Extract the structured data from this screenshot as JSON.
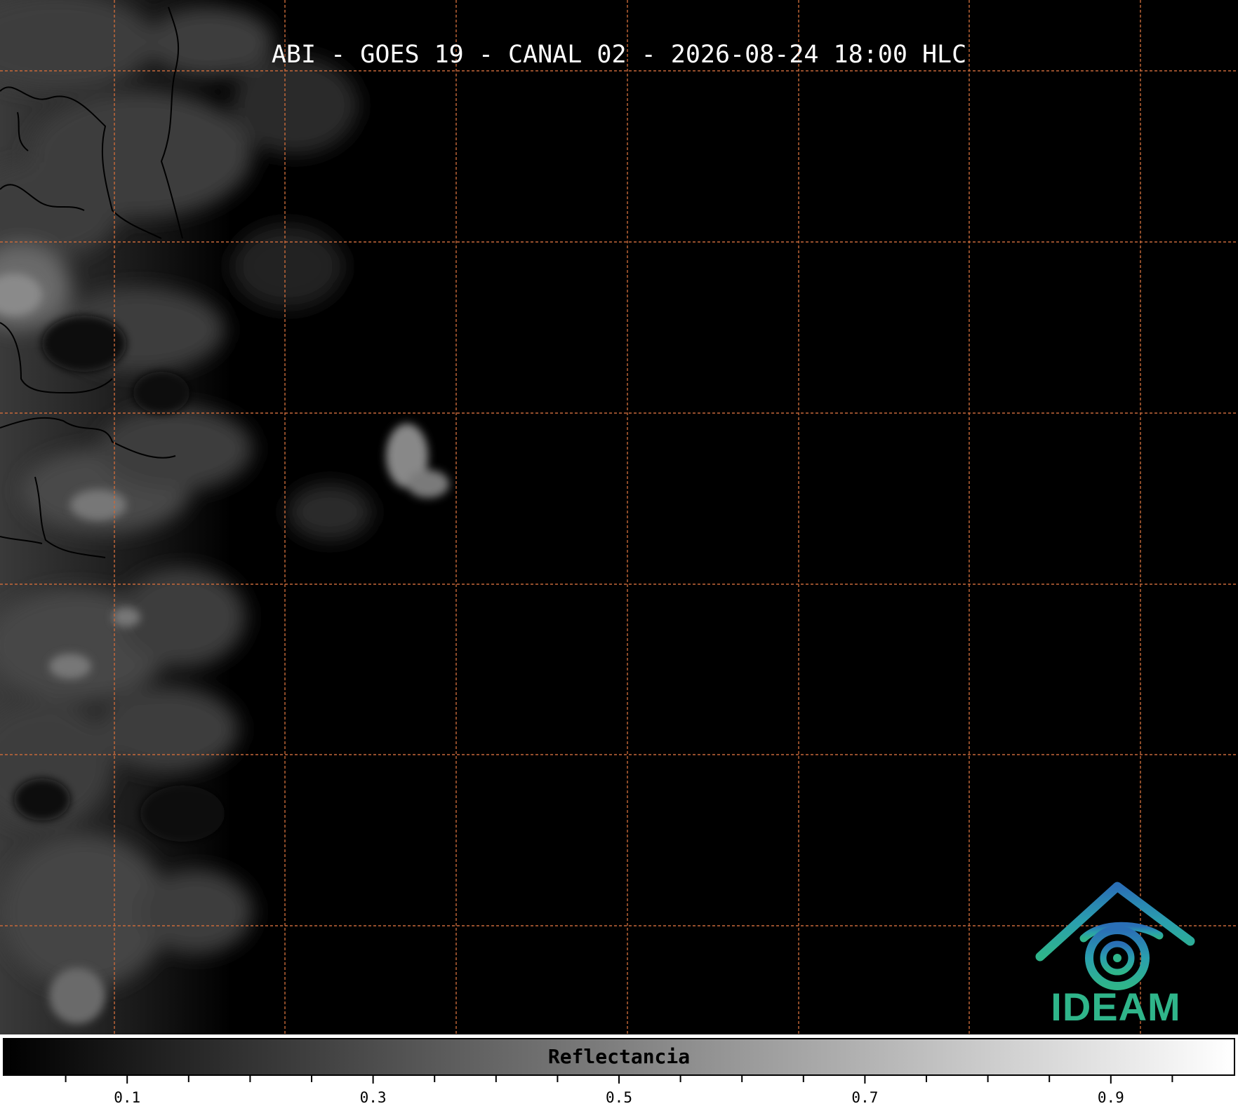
{
  "title": "ABI - GOES 19 - CANAL 02 - 2026-08-24 18:00 HLC",
  "colorbar": {
    "label": "Reflectancia",
    "range": [
      0.0,
      1.0
    ],
    "major_ticks": [
      "0.1",
      "0.3",
      "0.5",
      "0.7",
      "0.9"
    ],
    "major_values": [
      0.1,
      0.3,
      0.5,
      0.7,
      0.9
    ],
    "minor_step": 0.05,
    "colormap": [
      "#000000",
      "#ffffff"
    ]
  },
  "map": {
    "background": "#000000",
    "gridline_color": "#c8693a",
    "gridline_style": "dashed",
    "border_color": "#000000"
  },
  "logo": {
    "text": "IDEAM",
    "colors": [
      "#2a6fb6",
      "#2a9fae",
      "#2fb58a"
    ]
  },
  "icons": {
    "logo": "ideam-logo-icon"
  }
}
